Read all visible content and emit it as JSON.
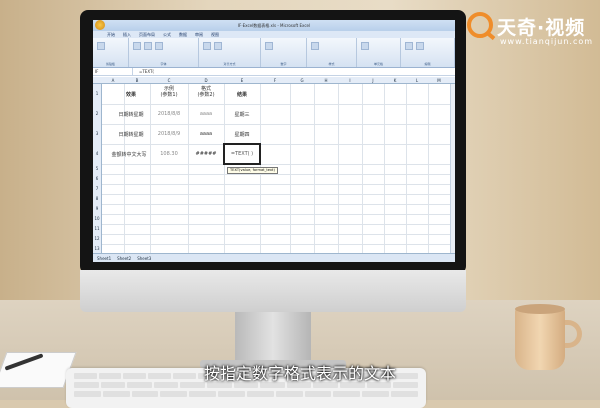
{
  "logo": {
    "brand": "天奇·视频",
    "url": "www.tianqijun.com"
  },
  "window": {
    "title": "IF·Excel数据表格.xls - Microsoft Excel"
  },
  "menu": [
    "开始",
    "插入",
    "页面布局",
    "公式",
    "数据",
    "审阅",
    "视图"
  ],
  "ribbon_groups": [
    "剪贴板",
    "字体",
    "对齐方式",
    "数字",
    "样式",
    "单元格",
    "编辑"
  ],
  "formula": {
    "name_box": "IF",
    "content": "=TEXT("
  },
  "columns": [
    "A",
    "B",
    "C",
    "D",
    "E",
    "F",
    "G",
    "H",
    "I",
    "J",
    "K",
    "L",
    "M",
    "N"
  ],
  "rows": [
    "1",
    "2",
    "3",
    "4",
    "5",
    "6",
    "7",
    "8",
    "9",
    "10",
    "11",
    "12",
    "13",
    "14",
    "15",
    "16",
    "17",
    "18",
    "19",
    "20",
    "21",
    "22",
    "23",
    "24",
    "25"
  ],
  "table": {
    "header": [
      "效果",
      "示例\n(参数1)",
      "格式\n(参数2)",
      "结果"
    ],
    "row1": [
      "日期转星期",
      "2018/8/8",
      "aaaa",
      "星期三"
    ],
    "row2": [
      "日期转星期",
      "2018/8/9",
      "aaaa",
      "星期四"
    ],
    "row3": [
      "金额转中文大写",
      "108.30",
      "#####",
      "=TEXT( )"
    ]
  },
  "tooltip": "TEXT(value, format_text)",
  "sheet_tabs": [
    "Sheet1",
    "Sheet2",
    "Sheet3"
  ],
  "subtitle": "按指定数字格式表示的文本",
  "colors": {
    "accent": "#ef8d2b",
    "ribbon": "#d5e2f2"
  }
}
